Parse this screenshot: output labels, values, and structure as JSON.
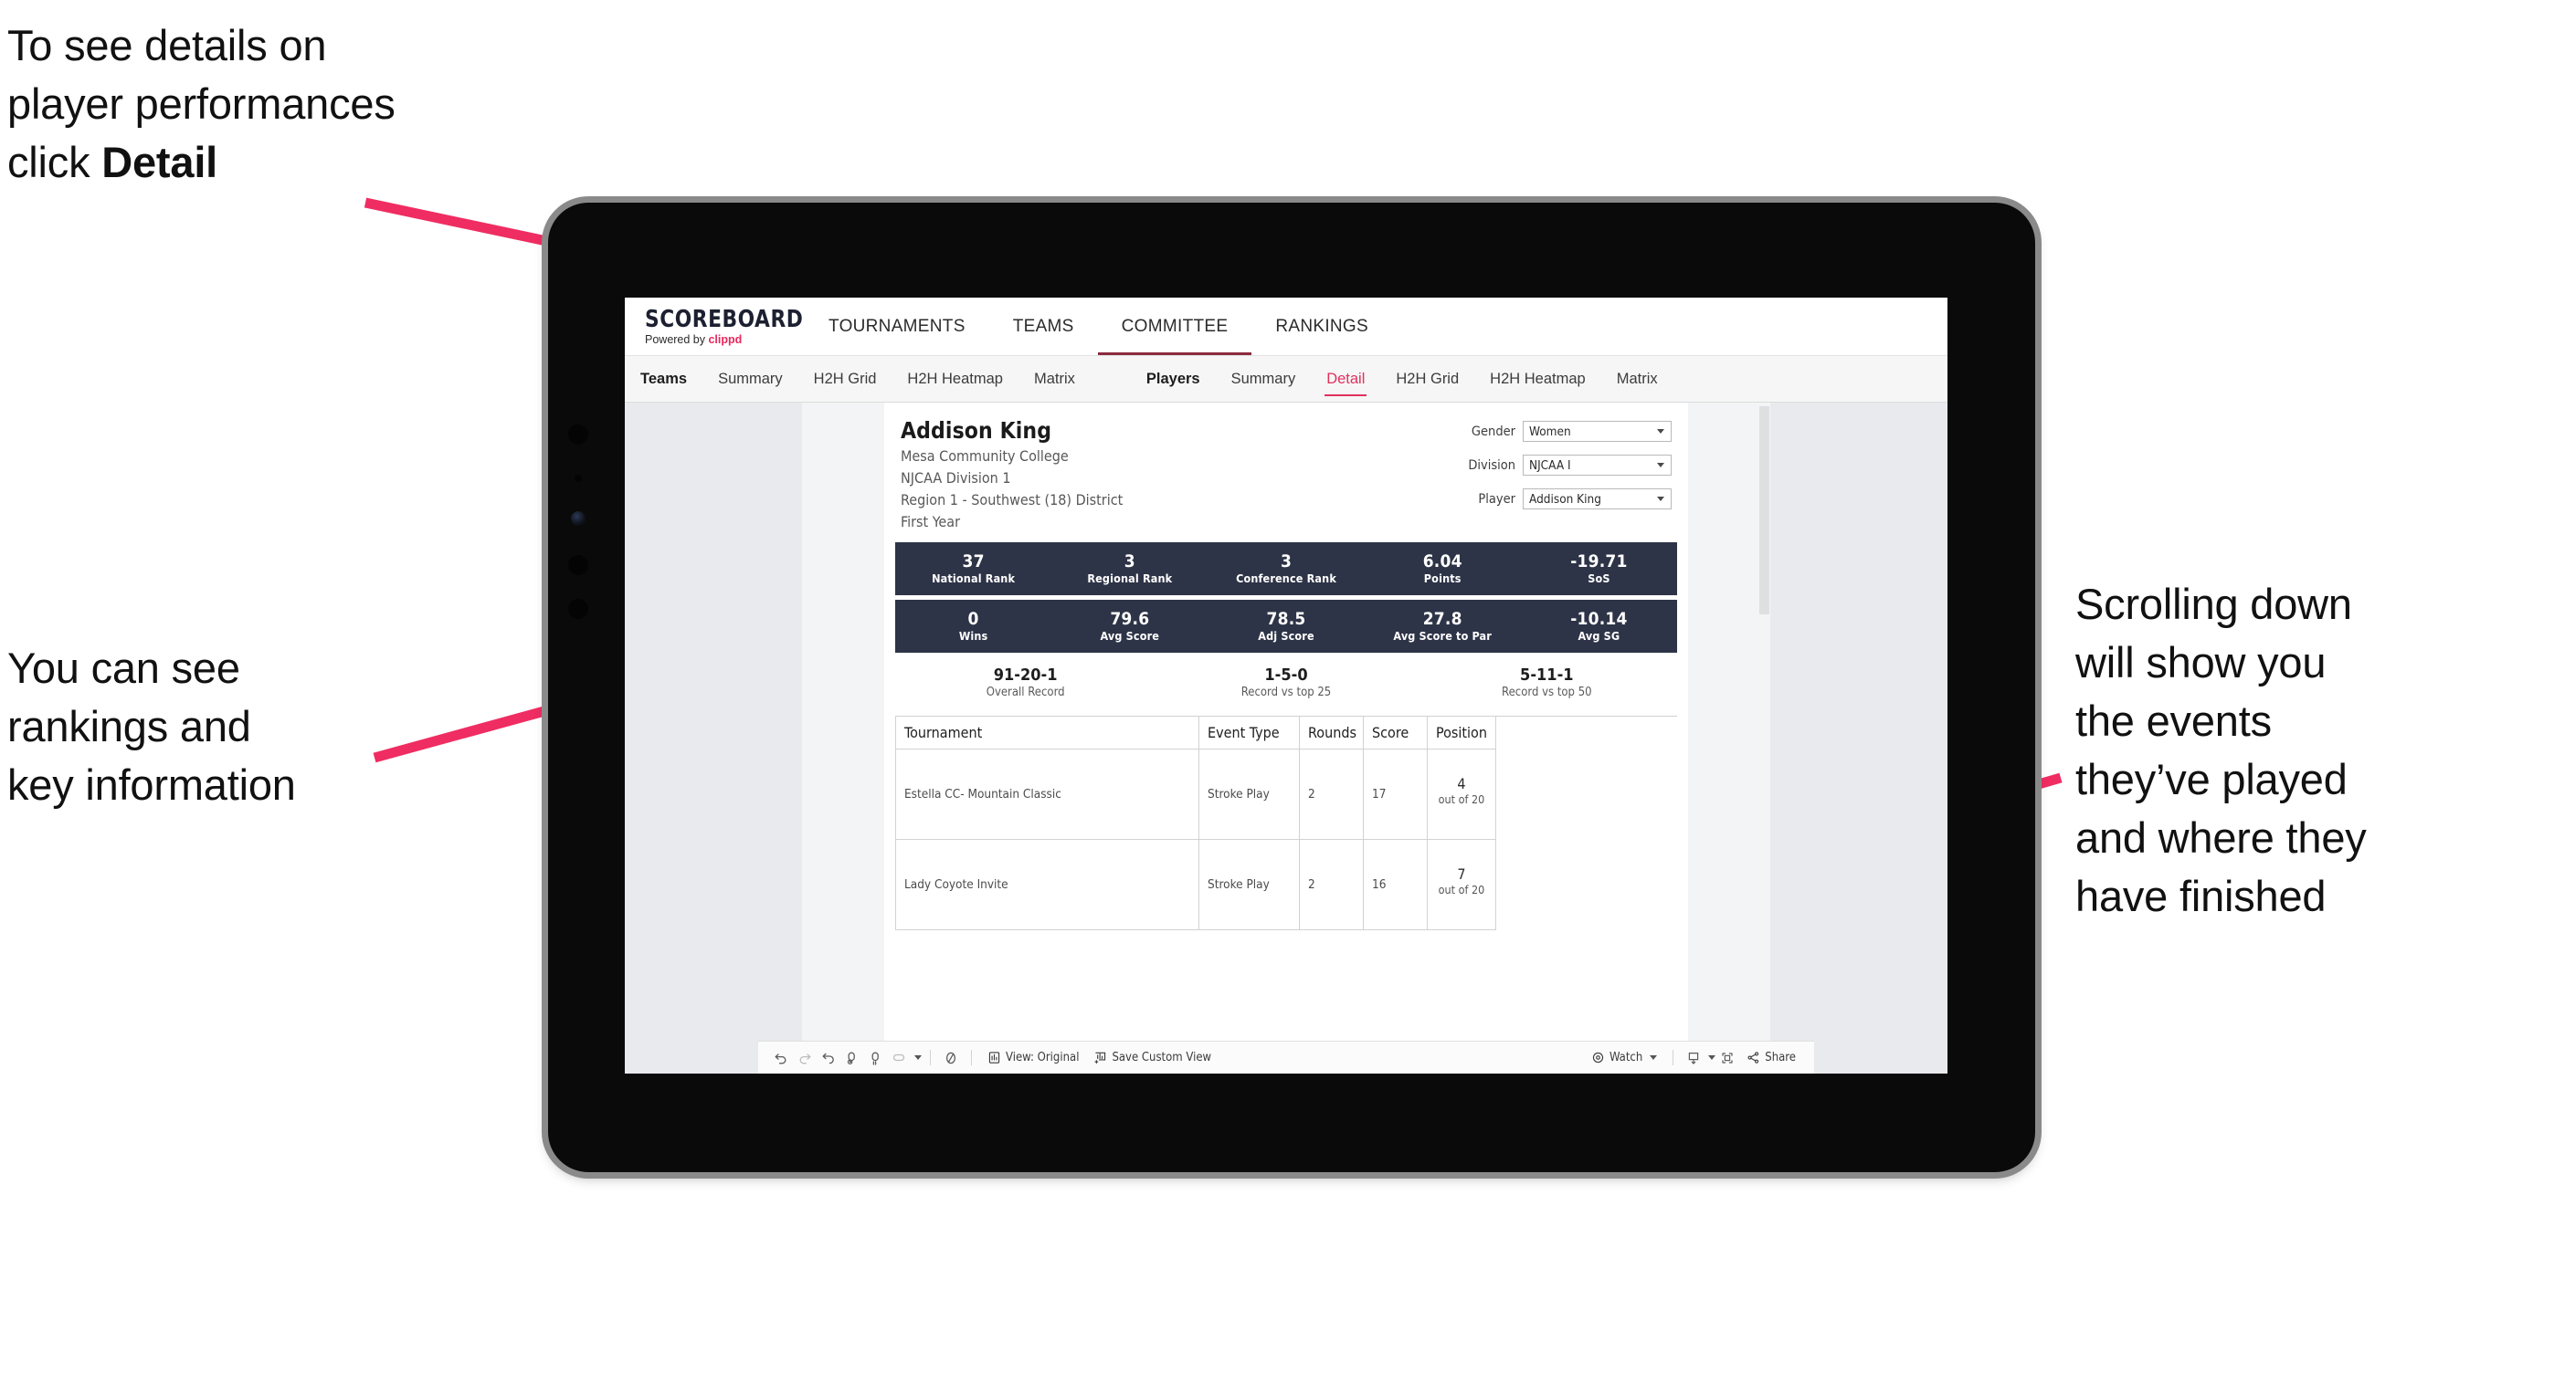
{
  "annotations": {
    "detail": "To see details on\nplayer performances\nclick ",
    "detail_bold": "Detail",
    "rankings": "You can see\nrankings and\nkey information",
    "scroll": "Scrolling down\nwill show you\nthe events\nthey’ve played\nand where they\nhave finished"
  },
  "colors": {
    "accent_pink": "#e8285d",
    "arrow_pink": "#ef2d62",
    "band_navy": "#2e3447",
    "tab_active": "#e0315c",
    "screen_bg": "#e8eaed"
  },
  "brand": {
    "title": "SCOREBOARD",
    "powered_prefix": "Powered by ",
    "powered_name": "clippd"
  },
  "topnav": {
    "items": [
      {
        "label": "TOURNAMENTS",
        "active": false
      },
      {
        "label": "TEAMS",
        "active": false
      },
      {
        "label": "COMMITTEE",
        "active": true
      },
      {
        "label": "RANKINGS",
        "active": false
      }
    ]
  },
  "subnav": {
    "group_teams": [
      {
        "label": "Teams",
        "bold": true
      },
      {
        "label": "Summary",
        "bold": false
      },
      {
        "label": "H2H Grid",
        "bold": false
      },
      {
        "label": "H2H Heatmap",
        "bold": false
      },
      {
        "label": "Matrix",
        "bold": false
      }
    ],
    "group_players": [
      {
        "label": "Players",
        "bold": true,
        "selected": false
      },
      {
        "label": "Summary",
        "bold": false,
        "selected": false
      },
      {
        "label": "Detail",
        "bold": false,
        "selected": true
      },
      {
        "label": "H2H Grid",
        "bold": false,
        "selected": false
      },
      {
        "label": "H2H Heatmap",
        "bold": false,
        "selected": false
      },
      {
        "label": "Matrix",
        "bold": false,
        "selected": false
      }
    ]
  },
  "player": {
    "name": "Addison King",
    "college": "Mesa Community College",
    "division": "NJCAA Division 1",
    "region": "Region 1 - Southwest (18) District",
    "year": "First Year"
  },
  "filters": [
    {
      "label": "Gender",
      "value": "Women"
    },
    {
      "label": "Division",
      "value": "NJCAA I"
    },
    {
      "label": "Player",
      "value": "Addison King"
    }
  ],
  "stat_bands": [
    [
      {
        "value": "37",
        "label": "National Rank"
      },
      {
        "value": "3",
        "label": "Regional Rank"
      },
      {
        "value": "3",
        "label": "Conference Rank"
      },
      {
        "value": "6.04",
        "label": "Points"
      },
      {
        "value": "-19.71",
        "label": "SoS"
      }
    ],
    [
      {
        "value": "0",
        "label": "Wins"
      },
      {
        "value": "79.6",
        "label": "Avg Score"
      },
      {
        "value": "78.5",
        "label": "Adj Score"
      },
      {
        "value": "27.8",
        "label": "Avg Score to Par"
      },
      {
        "value": "-10.14",
        "label": "Avg SG"
      }
    ]
  ],
  "records": [
    {
      "value": "91-20-1",
      "label": "Overall Record"
    },
    {
      "value": "1-5-0",
      "label": "Record vs top 25"
    },
    {
      "value": "5-11-1",
      "label": "Record vs top 50"
    }
  ],
  "table": {
    "columns": [
      "Tournament",
      "Event Type",
      "Rounds",
      "Score",
      "Position"
    ],
    "rows": [
      {
        "tournament": "Estella CC- Mountain Classic",
        "event_type": "Stroke Play",
        "rounds": "2",
        "score": "17",
        "position_num": "4",
        "position_of": "out of 20"
      },
      {
        "tournament": "Lady Coyote Invite",
        "event_type": "Stroke Play",
        "rounds": "2",
        "score": "16",
        "position_num": "7",
        "position_of": "out of 20"
      }
    ]
  },
  "toolbar": {
    "view_original": "View: Original",
    "save_custom_view": "Save Custom View",
    "watch": "Watch",
    "share": "Share"
  }
}
